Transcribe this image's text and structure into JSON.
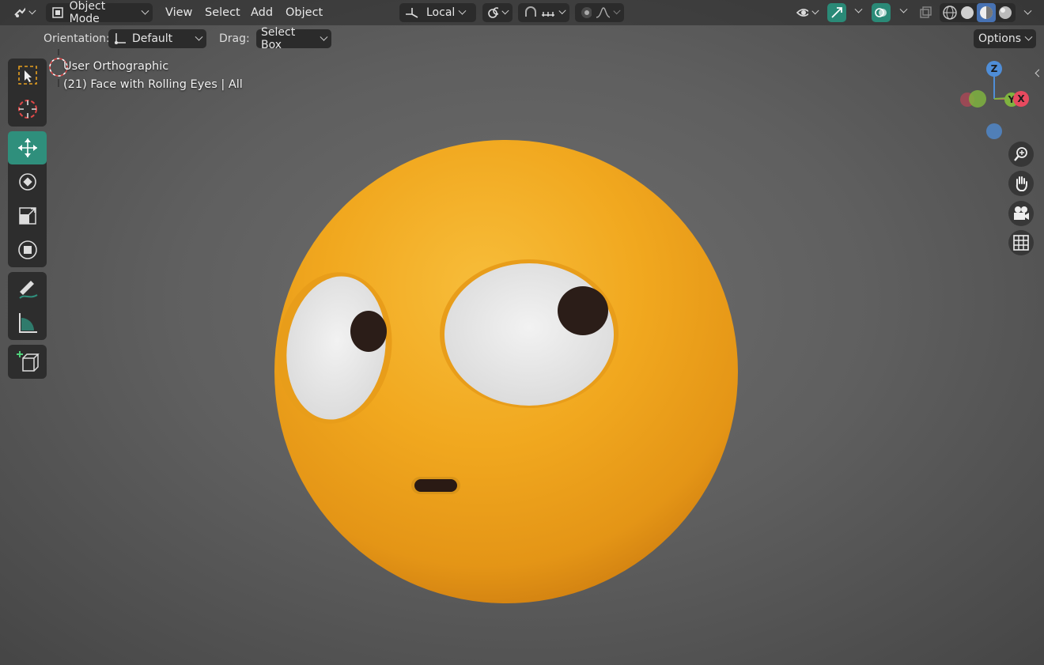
{
  "header": {
    "mode_label": "Object Mode",
    "menus": [
      "View",
      "Select",
      "Add",
      "Object"
    ],
    "transform_orientation": "Local",
    "options_label": "Options"
  },
  "tool_settings": {
    "orientation_label": "Orientation:",
    "orientation_value": "Default",
    "drag_label": "Drag:",
    "drag_value": "Select Box"
  },
  "overlay": {
    "view_name": "User Orthographic",
    "object_info": "(21) Face with Rolling Eyes | All"
  },
  "gizmo": {
    "z_label": "Z",
    "y_label": "Y",
    "x_label": "X"
  },
  "toolbar": {
    "tools": [
      "select-box-icon",
      "cursor-icon",
      "move-icon",
      "rotate-icon",
      "scale-icon",
      "transform-icon",
      "annotate-icon",
      "measure-icon",
      "add-cube-icon"
    ],
    "active_tool": "move-icon"
  },
  "colors": {
    "accent_teal": "#2f8f7c",
    "emoji_yellow": "#f2a91e",
    "axis_x": "#e84a5f",
    "axis_y": "#7fb33f",
    "axis_z": "#4f8ed8"
  }
}
